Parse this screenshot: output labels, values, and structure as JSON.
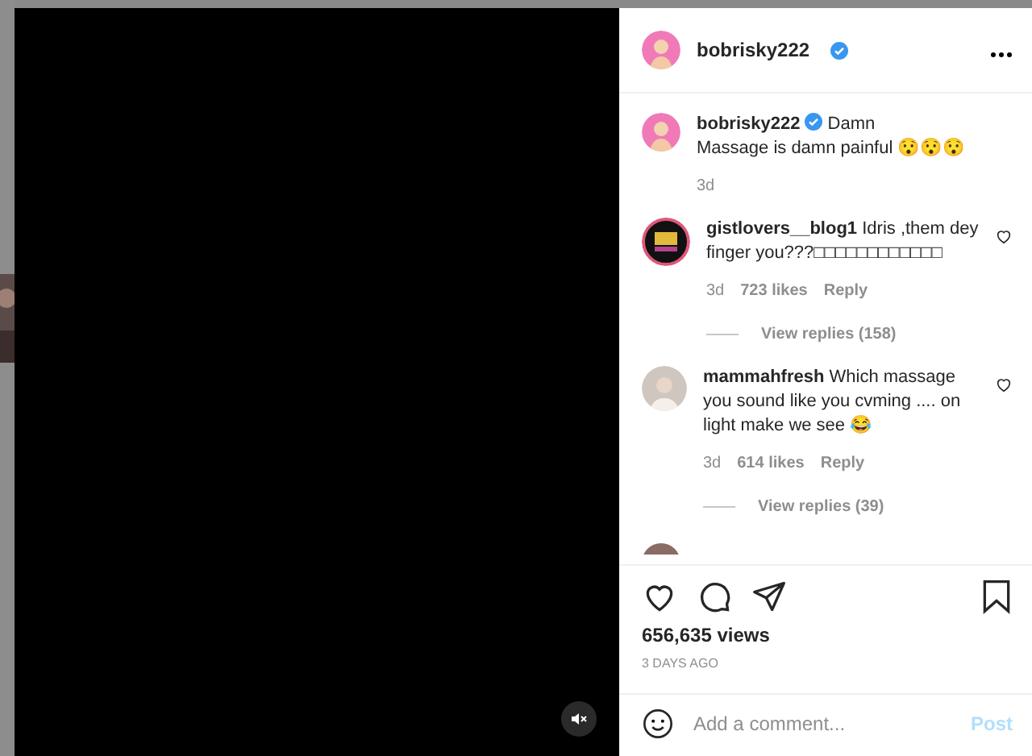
{
  "post": {
    "username": "bobrisky222",
    "verified": true
  },
  "caption": {
    "username": "bobrisky222",
    "verified": true,
    "text": "Damn\nMassage is damn painful 😯😯😯",
    "time": "3d"
  },
  "comments": [
    {
      "username": "gistlovers__blog1",
      "text": "Idris ,them dey finger you???□□□□□□□□□□□□",
      "time": "3d",
      "likes": "723 likes",
      "reply": "Reply",
      "view_replies": "View replies (158)",
      "liked": false,
      "kind": "logo"
    },
    {
      "username": "mammahfresh",
      "text": "Which massage you sound like you cvming .... on light make we see 😂",
      "time": "3d",
      "likes": "614 likes",
      "reply": "Reply",
      "view_replies": "View replies (39)",
      "liked": false,
      "kind": "person"
    }
  ],
  "video": {
    "muted": true
  },
  "views": "656,635 views",
  "date": "3 DAYS AGO",
  "comment_box": {
    "placeholder": "Add a comment...",
    "post": "Post"
  }
}
